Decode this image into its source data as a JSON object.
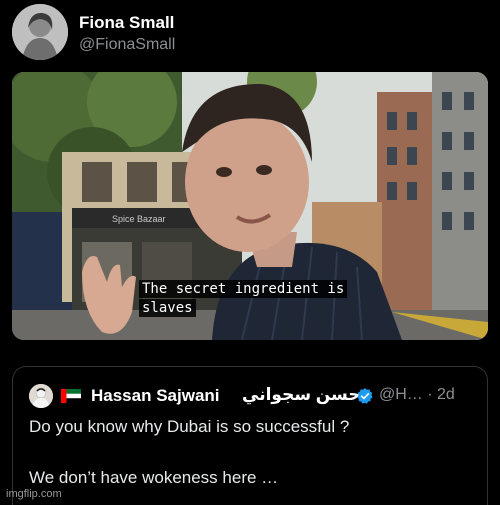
{
  "post": {
    "author_name": "Fiona Small",
    "author_handle": "@FionaSmall"
  },
  "video": {
    "shop_sign": "Spice Bazaar",
    "subtitle_line1": "The secret ingredient is",
    "subtitle_line2": "slaves"
  },
  "quoted_post": {
    "flag_icon": "uae-flag-icon",
    "verified_icon": "verified-badge-icon",
    "author_name": "Hassan Sajwani",
    "author_name_arabic": "حسن سجواني",
    "handle_time": "@H… · 2d",
    "text_line1": "Do you know why Dubai is so successful ?",
    "text_line2": "We don’t have wokeness here …"
  },
  "watermark": "imgflip.com",
  "colors": {
    "background": "#000000",
    "text_primary": "#e7e9ea",
    "text_secondary": "#8b8f94",
    "verified_blue": "#1d9bf0"
  }
}
